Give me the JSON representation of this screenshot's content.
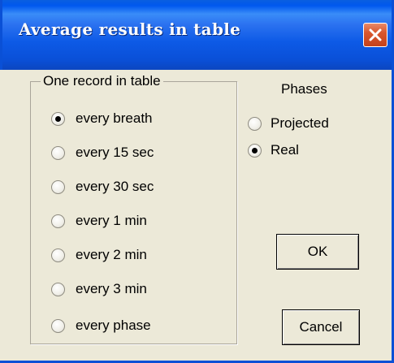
{
  "window": {
    "title": "Average results in table",
    "close_icon": "close-icon"
  },
  "group": {
    "label": "One record in table",
    "options": [
      {
        "label": "every breath",
        "checked": true
      },
      {
        "label": "every 15 sec",
        "checked": false
      },
      {
        "label": "every 30 sec",
        "checked": false
      },
      {
        "label": "every 1 min",
        "checked": false
      },
      {
        "label": "every 2 min",
        "checked": false
      },
      {
        "label": "every 3 min",
        "checked": false
      },
      {
        "label": "every phase",
        "checked": false
      }
    ]
  },
  "phases": {
    "label": "Phases",
    "options": [
      {
        "label": "Projected",
        "checked": false
      },
      {
        "label": "Real",
        "checked": true
      }
    ]
  },
  "buttons": {
    "ok": "OK",
    "cancel": "Cancel"
  },
  "colors": {
    "titlebar": "#0a50d8",
    "dialog_bg": "#ece9d8",
    "close_button": "#d9572e"
  }
}
